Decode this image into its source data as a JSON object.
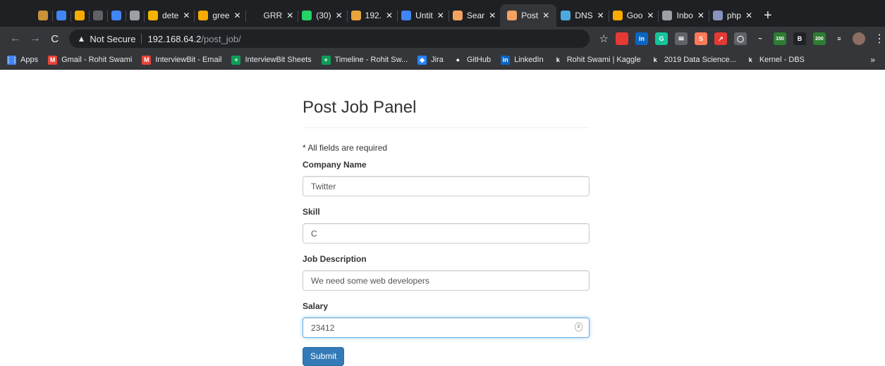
{
  "tabs": [
    {
      "title": "",
      "icon": "package-icon",
      "color": "#c8923a",
      "closable": false
    },
    {
      "title": "",
      "icon": "docs-icon",
      "color": "#4285f4",
      "closable": false
    },
    {
      "title": "",
      "icon": "analytics-icon",
      "color": "#f9ab00",
      "closable": false
    },
    {
      "title": "",
      "icon": "beta-icon",
      "color": "#5f6368",
      "closable": false
    },
    {
      "title": "",
      "icon": "calendar-icon",
      "color": "#4285f4",
      "closable": false
    },
    {
      "title": "",
      "icon": "mail-icon",
      "color": "#9aa0a6",
      "closable": false
    },
    {
      "title": "dete",
      "icon": "book-icon",
      "color": "#f4b400",
      "closable": true
    },
    {
      "title": "gree",
      "icon": "bee-icon",
      "color": "#f9ab00",
      "closable": true
    },
    {
      "title": "GRR",
      "icon": "blank-icon",
      "color": "#1f2023",
      "closable": true
    },
    {
      "title": "(30)",
      "icon": "whatsapp-icon",
      "color": "#25d366",
      "closable": true
    },
    {
      "title": "192.",
      "icon": "graph-icon",
      "color": "#e8a33d",
      "closable": true
    },
    {
      "title": "Untit",
      "icon": "docs-icon",
      "color": "#4285f4",
      "closable": true
    },
    {
      "title": "Sear",
      "icon": "codecademy-icon",
      "color": "#f4a261",
      "closable": true
    },
    {
      "title": "Post",
      "icon": "codecademy-icon",
      "color": "#f4a261",
      "closable": true,
      "active": true
    },
    {
      "title": "DNS",
      "icon": "shield-icon",
      "color": "#4ea8de",
      "closable": true
    },
    {
      "title": "Goo",
      "icon": "colab-icon",
      "color": "#f9ab00",
      "closable": true
    },
    {
      "title": "Inbo",
      "icon": "mail-icon",
      "color": "#9aa0a6",
      "closable": true
    },
    {
      "title": "php",
      "icon": "php-icon",
      "color": "#8892bf",
      "closable": true
    }
  ],
  "newtab_glyph": "+",
  "toolbar": {
    "back_glyph": "←",
    "forward_glyph": "→",
    "reload_glyph": "C",
    "security_label": "Not Secure",
    "url_host": "192.168.64.2",
    "url_path": "/post_job/",
    "star_glyph": "☆",
    "extensions": [
      {
        "icon": "flag-icon",
        "color": "#e53935",
        "label": ""
      },
      {
        "icon": "linkedin-icon",
        "color": "#0a66c2",
        "label": "in"
      },
      {
        "icon": "grammarly-icon",
        "color": "#15c39a",
        "label": "G"
      },
      {
        "icon": "mail-icon",
        "color": "#5f6368",
        "label": "✉"
      },
      {
        "icon": "hubspot-icon",
        "color": "#ff7a59",
        "label": "S"
      },
      {
        "icon": "arrow-icon",
        "color": "#e53935",
        "label": "↗"
      },
      {
        "icon": "ghost-icon",
        "color": "#5f6368",
        "label": "◯"
      },
      {
        "icon": "wave-icon",
        "color": "#35363a",
        "label": "~"
      },
      {
        "icon": "counter-icon",
        "color": "#2e7d32",
        "label": "150"
      },
      {
        "icon": "b-icon",
        "color": "#202124",
        "label": "B"
      },
      {
        "icon": "lock-icon",
        "color": "#2e7d32",
        "label": "200"
      },
      {
        "icon": "list-icon",
        "color": "#35363a",
        "label": "≡"
      },
      {
        "icon": "avatar",
        "color": "#8d6e63",
        "label": ""
      }
    ],
    "menu_glyph": "⋮"
  },
  "bookmarks": [
    {
      "label": "Apps",
      "icon": "apps-grid-icon",
      "color": "#4285f4",
      "glyph": "⋮⋮"
    },
    {
      "label": "Gmail - Rohit Swami",
      "icon": "gmail-icon",
      "color": "#ea4335",
      "glyph": "M"
    },
    {
      "label": "InterviewBit - Email",
      "icon": "gmail-icon",
      "color": "#ea4335",
      "glyph": "M"
    },
    {
      "label": "InterviewBit Sheets",
      "icon": "sheets-icon",
      "color": "#0f9d58",
      "glyph": "+"
    },
    {
      "label": "Timeline - Rohit Sw...",
      "icon": "sheets-icon",
      "color": "#0f9d58",
      "glyph": "+"
    },
    {
      "label": "Jira",
      "icon": "jira-icon",
      "color": "#2684ff",
      "glyph": "◆"
    },
    {
      "label": "GitHub",
      "icon": "github-icon",
      "color": "#35363a",
      "glyph": "●"
    },
    {
      "label": "LinkedIn",
      "icon": "linkedin-icon",
      "color": "#0a66c2",
      "glyph": "in"
    },
    {
      "label": "Rohit Swami | Kaggle",
      "icon": "kaggle-icon",
      "color": "#35363a",
      "glyph": "k"
    },
    {
      "label": "2019 Data Science...",
      "icon": "kaggle-icon",
      "color": "#35363a",
      "glyph": "k"
    },
    {
      "label": "Kernel - DBS",
      "icon": "kaggle-icon",
      "color": "#35363a",
      "glyph": "k"
    }
  ],
  "bookmarks_more_glyph": "»",
  "form": {
    "title": "Post Job Panel",
    "note": "* All fields are required",
    "fields": [
      {
        "label": "Company Name",
        "value": "Twitter"
      },
      {
        "label": "Skill",
        "value": "C"
      },
      {
        "label": "Job Description",
        "value": "We need some web developers"
      },
      {
        "label": "Salary",
        "value": "23412"
      }
    ],
    "spin_glyph": "⇕",
    "submit_label": "Submit"
  },
  "colors": {
    "accent": "#337ab7",
    "focus_ring": "#66afe9"
  }
}
